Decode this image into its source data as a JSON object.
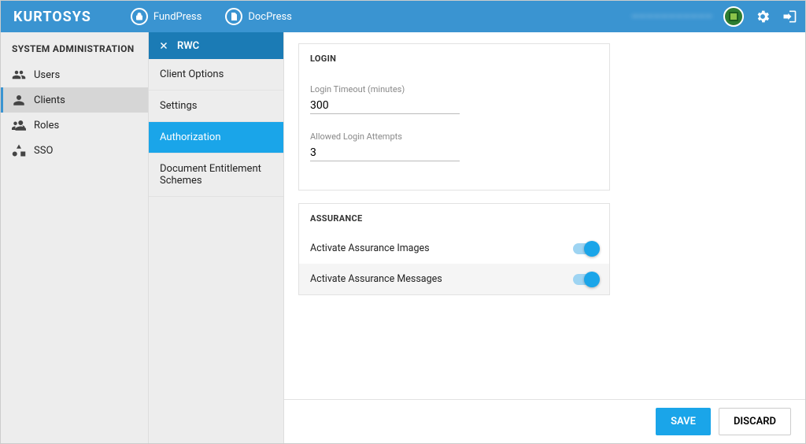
{
  "brand": "KURTOSYS",
  "topnav": {
    "fundpress": "FundPress",
    "docpress": "DocPress"
  },
  "user": {
    "name": "———————————"
  },
  "sidebar": {
    "heading": "SYSTEM ADMINISTRATION",
    "items": [
      {
        "label": "Users"
      },
      {
        "label": "Clients"
      },
      {
        "label": "Roles"
      },
      {
        "label": "SSO"
      }
    ]
  },
  "subpanel": {
    "title": "RWC",
    "items": [
      {
        "label": "Client Options"
      },
      {
        "label": "Settings"
      },
      {
        "label": "Authorization"
      },
      {
        "label": "Document Entitlement Schemes"
      }
    ]
  },
  "form": {
    "login_section": "LOGIN",
    "login_timeout_label": "Login Timeout (minutes)",
    "login_timeout_value": "300",
    "allowed_attempts_label": "Allowed Login Attempts",
    "allowed_attempts_value": "3",
    "assurance_section": "ASSURANCE",
    "assurance_images_label": "Activate Assurance Images",
    "assurance_images_on": true,
    "assurance_messages_label": "Activate Assurance Messages",
    "assurance_messages_on": true
  },
  "actions": {
    "save": "SAVE",
    "discard": "DISCARD"
  }
}
